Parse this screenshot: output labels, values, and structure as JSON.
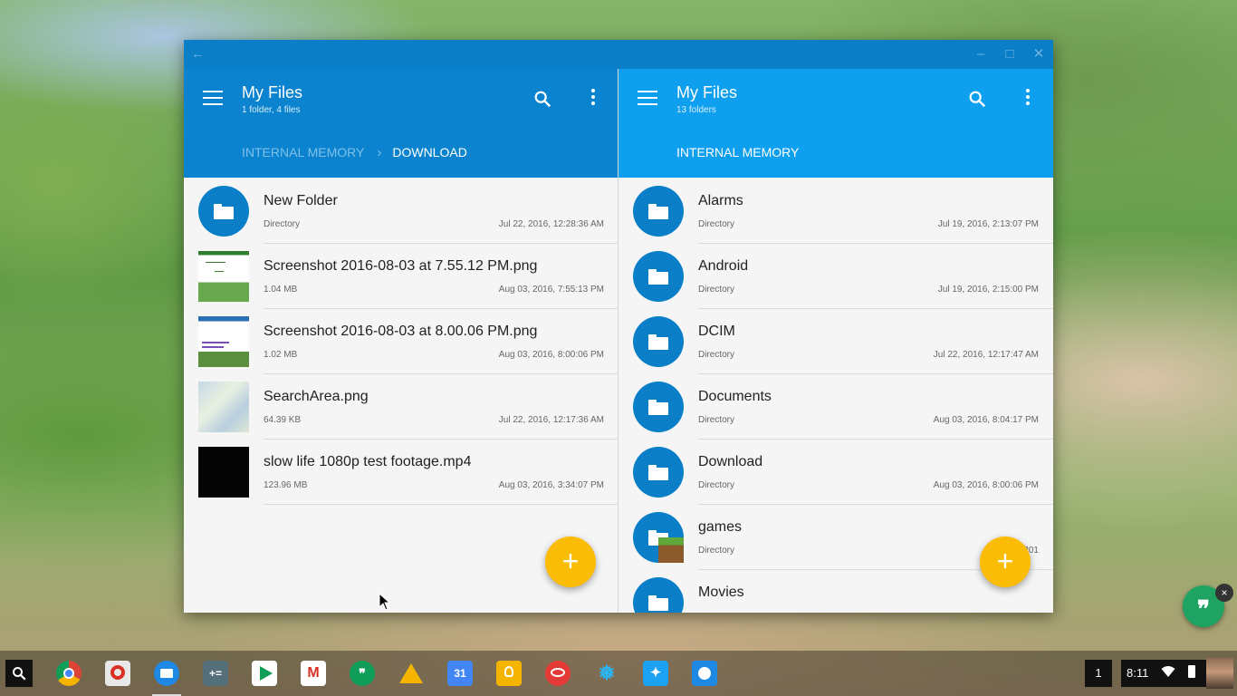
{
  "left_pane": {
    "title": "My Files",
    "subtitle": "1 folder, 4 files",
    "breadcrumbs": [
      "INTERNAL MEMORY",
      "DOWNLOAD"
    ],
    "items": [
      {
        "name": "New Folder",
        "meta": "Directory",
        "date": "Jul 22, 2016, 12:28:36 AM",
        "icon": "folder-icon"
      },
      {
        "name": "Screenshot 2016-08-03 at 7.55.12 PM.png",
        "meta": "1.04 MB",
        "date": "Aug 03, 2016, 7:55:13 PM",
        "icon": "image-thumbnail"
      },
      {
        "name": "Screenshot 2016-08-03 at 8.00.06 PM.png",
        "meta": "1.02 MB",
        "date": "Aug 03, 2016, 8:00:06 PM",
        "icon": "image-thumbnail"
      },
      {
        "name": "SearchArea.png",
        "meta": "64.39 KB",
        "date": "Jul 22, 2016, 12:17:36 AM",
        "icon": "map-thumbnail"
      },
      {
        "name": "slow life 1080p test footage.mp4",
        "meta": "123.96 MB",
        "date": "Aug 03, 2016, 3:34:07 PM",
        "icon": "video-thumbnail"
      }
    ]
  },
  "right_pane": {
    "title": "My Files",
    "subtitle": "13 folders",
    "breadcrumbs": [
      "INTERNAL MEMORY"
    ],
    "items": [
      {
        "name": "Alarms",
        "meta": "Directory",
        "date": "Jul 19, 2016, 2:13:07 PM"
      },
      {
        "name": "Android",
        "meta": "Directory",
        "date": "Jul 19, 2016, 2:15:00 PM"
      },
      {
        "name": "DCIM",
        "meta": "Directory",
        "date": "Jul 22, 2016, 12:17:47 AM"
      },
      {
        "name": "Documents",
        "meta": "Directory",
        "date": "Aug 03, 2016, 8:04:17 PM"
      },
      {
        "name": "Download",
        "meta": "Directory",
        "date": "Aug 03, 2016, 8:00:06 PM"
      },
      {
        "name": "games",
        "meta": "Directory",
        "date": "Jul 20, 201"
      },
      {
        "name": "Movies",
        "meta": "",
        "date": ""
      }
    ]
  },
  "fab": {
    "label": "+"
  },
  "hangouts": {
    "glyph": "❞",
    "close": "×"
  },
  "shelf": {
    "apps": [
      {
        "name": "chrome-icon",
        "color": "#db4437"
      },
      {
        "name": "remote-desktop-icon",
        "color": "#e0e0e0"
      },
      {
        "name": "files-icon",
        "color": "#1e88e5"
      },
      {
        "name": "calculator-icon",
        "color": "#546e7a"
      },
      {
        "name": "play-store-icon",
        "color": "#ffffff"
      },
      {
        "name": "gmail-icon",
        "color": "#ffffff"
      },
      {
        "name": "hangouts-icon",
        "color": "#0f9d58"
      },
      {
        "name": "drive-icon",
        "color": "#ffffff"
      },
      {
        "name": "calendar-icon",
        "color": "#4285f4"
      },
      {
        "name": "keep-icon",
        "color": "#f4b400"
      },
      {
        "name": "acrobat-icon",
        "color": "#e53935"
      },
      {
        "name": "tweetdeck-butterfly-icon",
        "color": "#29b6f6"
      },
      {
        "name": "twitter-icon",
        "color": "#1da1f2"
      },
      {
        "name": "photo-viewer-icon",
        "color": "#1e88e5"
      }
    ],
    "calendar_day": "31",
    "workspace_number": "1",
    "time": "8:11"
  },
  "colors": {
    "left_appbar": "#0b83cf",
    "right_appbar": "#0ea0ee",
    "folder_avatar": "#0a7fc8",
    "fab": "#fbbc05",
    "hangouts_bubble": "#1ea362"
  }
}
